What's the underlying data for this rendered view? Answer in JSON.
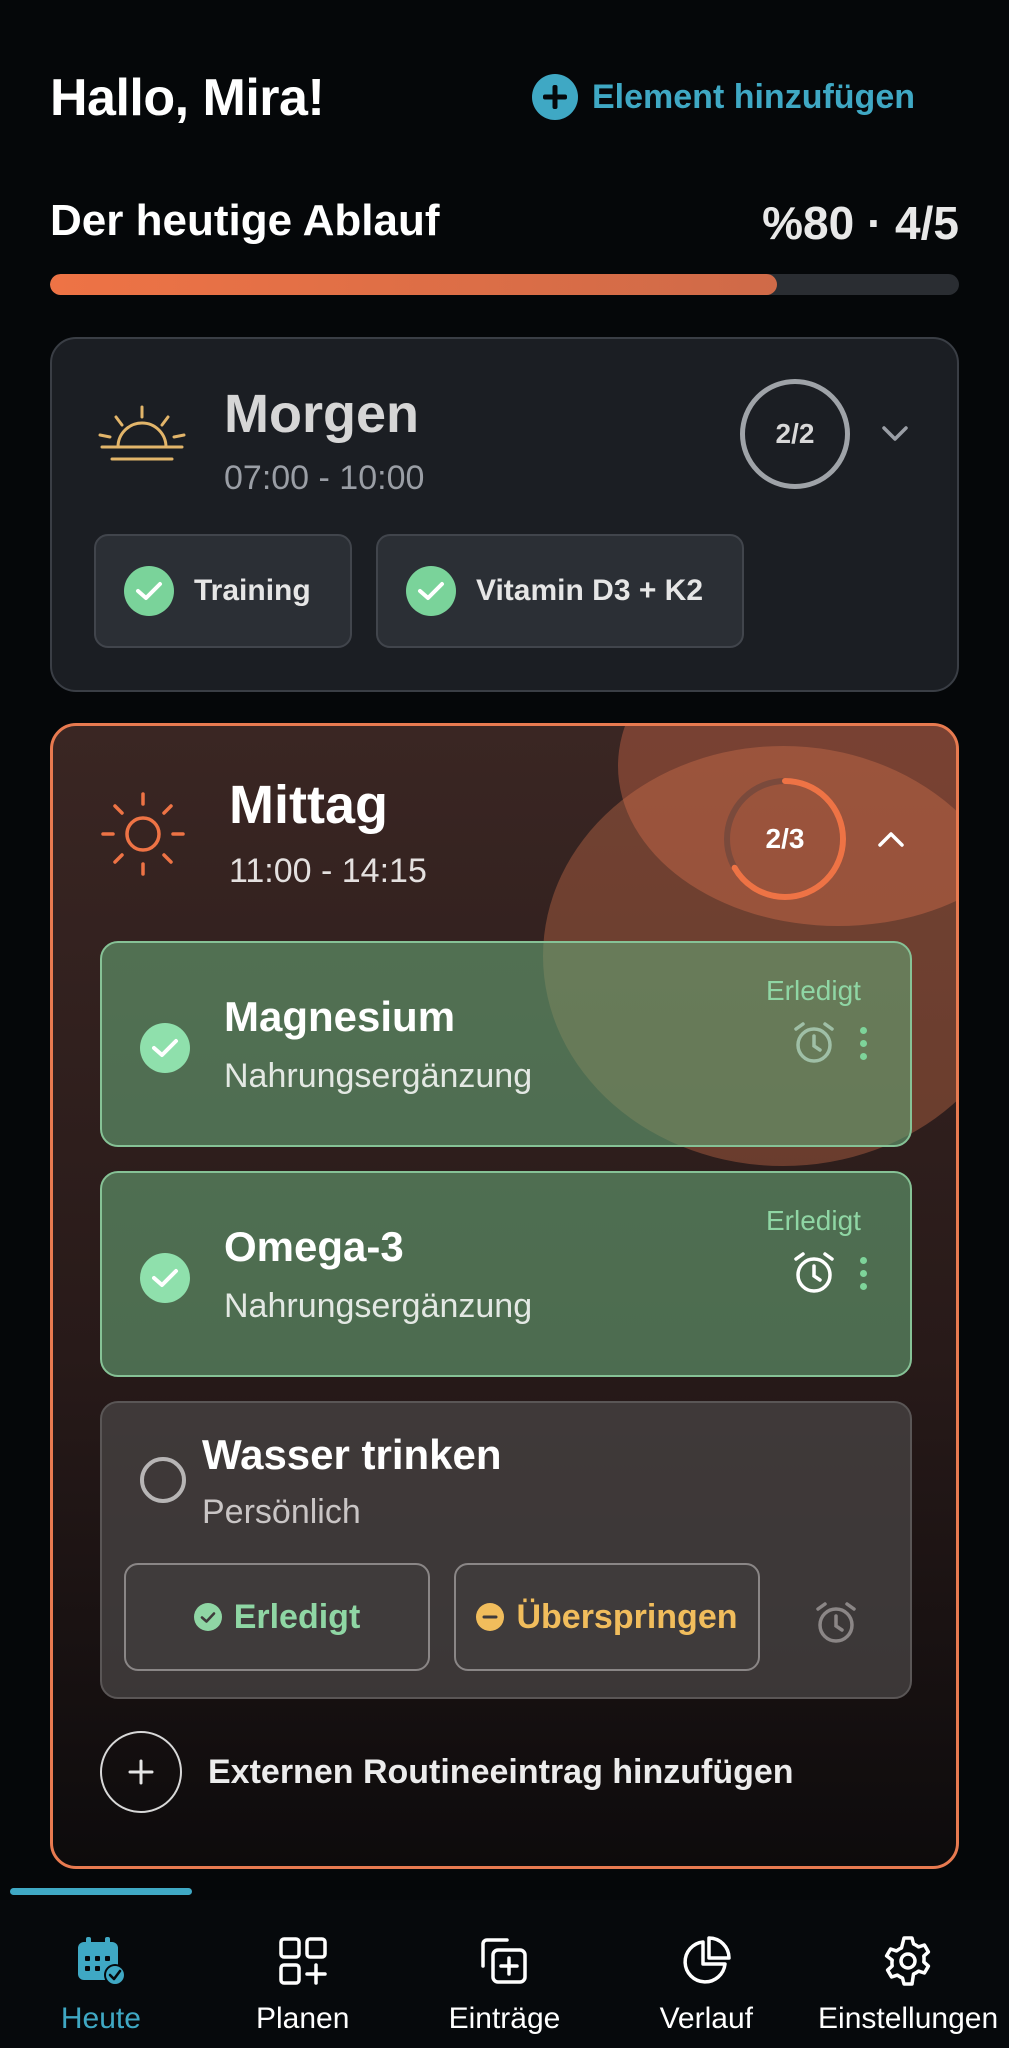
{
  "header": {
    "greeting": "Hallo, Mira!",
    "add_element_label": "Element hinzufügen"
  },
  "routine": {
    "title": "Der heutige Ablauf",
    "stats": "%80 · 4/5",
    "progress_fraction": 0.8
  },
  "morning": {
    "title": "Morgen",
    "time": "07:00 - 10:00",
    "progress_label": "2/2",
    "chips": [
      {
        "label": "Training"
      },
      {
        "label": "Vitamin D3 + K2"
      }
    ]
  },
  "noon": {
    "title": "Mittag",
    "time": "11:00 - 14:15",
    "progress_label": "2/3",
    "progress_fraction": 0.6667,
    "items": [
      {
        "title": "Magnesium",
        "subtitle": "Nahrungsergänzung",
        "status": "Erledigt"
      },
      {
        "title": "Omega-3",
        "subtitle": "Nahrungsergänzung",
        "status": "Erledigt"
      }
    ],
    "pending_item": {
      "title": "Wasser trinken",
      "subtitle": "Persönlich",
      "done_label": "Erledigt",
      "skip_label": "Überspringen"
    },
    "add_external_label": "Externen Routineeintrag hinzufügen"
  },
  "nav": {
    "items": [
      {
        "label": "Heute",
        "icon": "calendar-check-icon",
        "active": true
      },
      {
        "label": "Planen",
        "icon": "grid-plus-icon",
        "active": false
      },
      {
        "label": "Einträge",
        "icon": "copy-plus-icon",
        "active": false
      },
      {
        "label": "Verlauf",
        "icon": "pie-chart-icon",
        "active": false
      },
      {
        "label": "Einstellungen",
        "icon": "gear-icon",
        "active": false
      }
    ]
  },
  "colors": {
    "accent": "#3fa8c4",
    "orange": "#ee7345",
    "done_green": "#7ad39a",
    "skip_yellow": "#f1bd5c"
  }
}
